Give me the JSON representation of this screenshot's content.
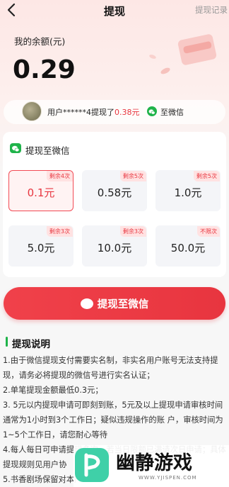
{
  "header": {
    "title": "提现",
    "record_link": "提现记录"
  },
  "balance": {
    "label": "我的余额(元)",
    "value": "0.29"
  },
  "ticker": {
    "prefix": "用户******4提现了",
    "amount": "0.38元",
    "destination": "至微信"
  },
  "withdraw_card": {
    "title": "提现至微信",
    "options": [
      {
        "amount": "0.1元",
        "badge": "剩余4次",
        "selected": true
      },
      {
        "amount": "0.58元",
        "badge": "剩余5次",
        "selected": false
      },
      {
        "amount": "1.0元",
        "badge": "剩余5次",
        "selected": false
      },
      {
        "amount": "5.0元",
        "badge": "剩余3次",
        "selected": false
      },
      {
        "amount": "10.0元",
        "badge": "剩余3次",
        "selected": false
      },
      {
        "amount": "50.0元",
        "badge": "不限次",
        "selected": false
      }
    ]
  },
  "submit_button": {
    "label": "提现至微信"
  },
  "rules": {
    "title": "提现说明",
    "items": [
      "1.由于微信提现支付需要实名制，非实名用户账号无法支持提现，请务必将提现的微信号进行实名认证；",
      "2.单笔提现金额最低0.3元；",
      "3. 5元以内提现申请可即刻到账，5元及以上提现申请审核时间通常为1小时到3个工作日；疑似违规操作的账 户，审核时间为1~5个工作日，请您耐心等待",
      "4.每人每日可申请提现多次，若当日限额已满请次日申请；具体提现规则见用户协",
      "5.书香剧场保留对本产"
    ]
  },
  "watermark": {
    "text": "幽静游戏",
    "url": "WWW.YJISPEN.COM"
  },
  "colors": {
    "accent": "#e8353f",
    "wechat_green": "#1fb34a"
  }
}
